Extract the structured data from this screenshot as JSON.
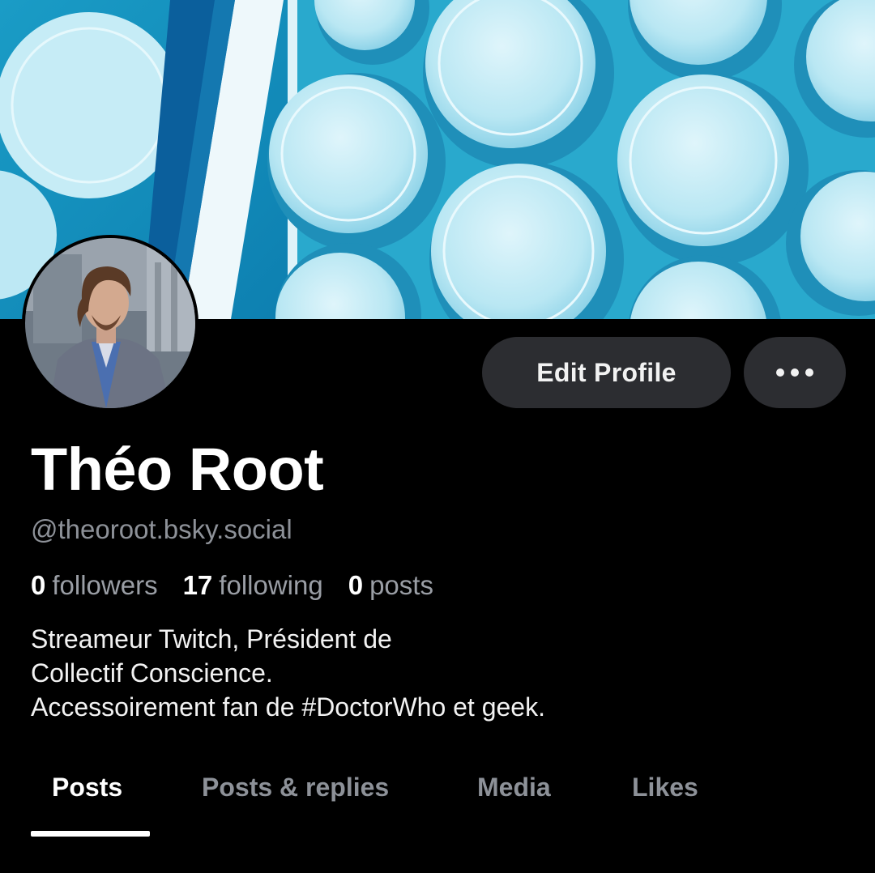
{
  "colors": {
    "background": "#000000",
    "button_bg": "#2c2d31",
    "muted_text": "#8d9198",
    "banner_blue": "#1b9fc4"
  },
  "banner": {
    "icon": "banner-image"
  },
  "avatar": {
    "icon": "avatar-photo"
  },
  "actions": {
    "edit_profile_label": "Edit Profile",
    "more_icon": "more-horizontal-icon"
  },
  "profile": {
    "display_name": "Théo Root",
    "handle": "@theoroot.bsky.social"
  },
  "stats": {
    "followers_count": "0",
    "followers_label": "followers",
    "following_count": "17",
    "following_label": "following",
    "posts_count": "0",
    "posts_label": "posts"
  },
  "bio": {
    "lines": [
      "Streameur Twitch, Président de",
      "Collectif Conscience.",
      "Accessoirement fan de #DoctorWho et geek."
    ]
  },
  "tabs": [
    {
      "label": "Posts",
      "active": true
    },
    {
      "label": "Posts & replies",
      "active": false
    },
    {
      "label": "Media",
      "active": false
    },
    {
      "label": "Likes",
      "active": false
    }
  ]
}
